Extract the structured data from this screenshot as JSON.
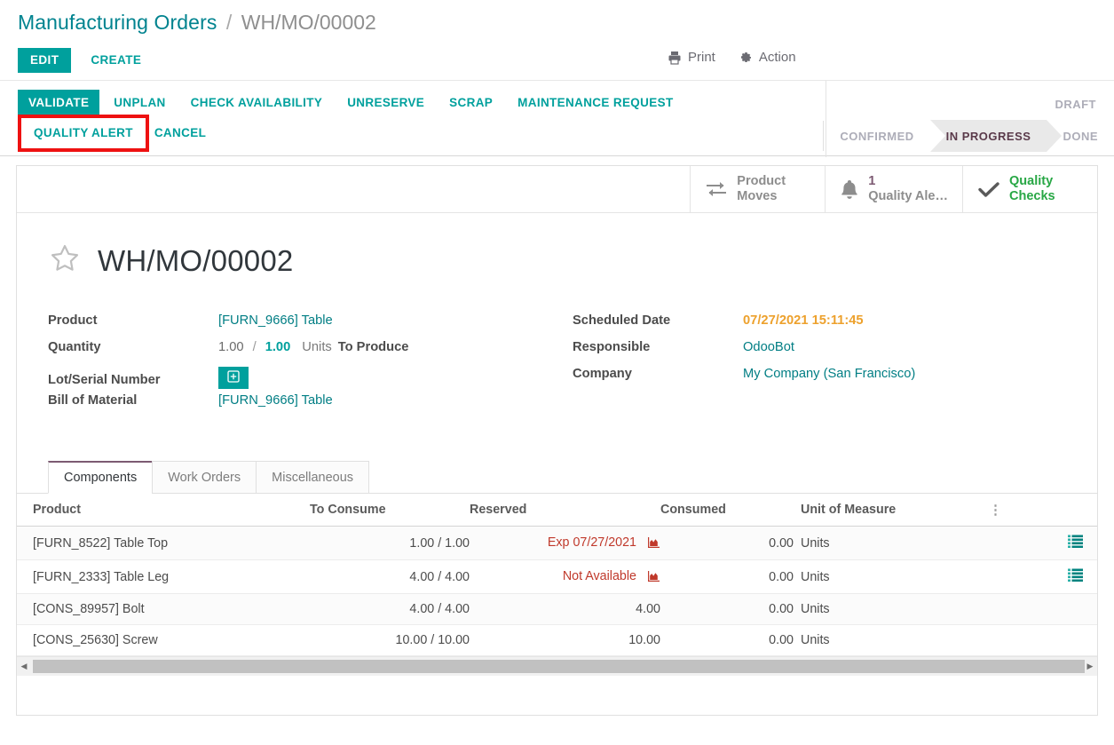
{
  "breadcrumb": {
    "root": "Manufacturing Orders",
    "separator": "/",
    "current": "WH/MO/00002"
  },
  "toolbar": {
    "edit_label": "EDIT",
    "create_label": "CREATE",
    "print_label": "Print",
    "action_label": "Action"
  },
  "action_buttons": [
    {
      "label": "VALIDATE",
      "primary": true
    },
    {
      "label": "UNPLAN",
      "primary": false
    },
    {
      "label": "CHECK AVAILABILITY",
      "primary": false
    },
    {
      "label": "UNRESERVE",
      "primary": false
    },
    {
      "label": "SCRAP",
      "primary": false
    },
    {
      "label": "MAINTENANCE REQUEST",
      "primary": false
    },
    {
      "label": "QUALITY ALERT",
      "primary": false,
      "highlighted": true
    },
    {
      "label": "CANCEL",
      "primary": false
    }
  ],
  "statusbar": {
    "stages": [
      "DRAFT",
      "CONFIRMED",
      "IN PROGRESS",
      "DONE"
    ],
    "draft": "DRAFT",
    "confirmed": "CONFIRMED",
    "in_progress": "IN PROGRESS",
    "done": "DONE",
    "active": "IN PROGRESS"
  },
  "smart_buttons": [
    {
      "icon": "exchange-icon",
      "count": "",
      "label": "Product\nMoves",
      "line1": "Product",
      "line2": "Moves"
    },
    {
      "icon": "bell-icon",
      "count": "1",
      "label": "Quality Ale…",
      "line1": "1",
      "line2": "Quality Ale…"
    },
    {
      "icon": "check-icon",
      "count": "",
      "label": "Quality Checks",
      "line1": "Quality",
      "line2": "Checks"
    }
  ],
  "record": {
    "title": "WH/MO/00002",
    "fields_left": {
      "product_label": "Product",
      "product_value": "[FURN_9666] Table",
      "quantity_label": "Quantity",
      "quantity_done": "1.00",
      "quantity_sep": "/",
      "quantity_todo": "1.00",
      "quantity_uom": "Units",
      "quantity_suffix": "To Produce",
      "lot_label": "Lot/Serial Number",
      "bom_label": "Bill of Material",
      "bom_value": "[FURN_9666] Table"
    },
    "fields_right": {
      "scheduled_label": "Scheduled Date",
      "scheduled_value": "07/27/2021 15:11:45",
      "responsible_label": "Responsible",
      "responsible_value": "OdooBot",
      "company_label": "Company",
      "company_value": "My Company (San Francisco)"
    }
  },
  "notebook": {
    "tabs": [
      {
        "label": "Components",
        "active": true
      },
      {
        "label": "Work Orders",
        "active": false
      },
      {
        "label": "Miscellaneous",
        "active": false
      }
    ]
  },
  "components_table": {
    "columns": [
      "Product",
      "To Consume",
      "Reserved",
      "Consumed",
      "Unit of Measure"
    ],
    "rows": [
      {
        "product": "[FURN_8522] Table Top",
        "to_consume": "1.00 / 1.00",
        "reserved": "Exp 07/27/2021",
        "reserved_state": "warning",
        "consumed": "0.00",
        "uom": "Units",
        "has_detail_icon": true
      },
      {
        "product": "[FURN_2333] Table Leg",
        "to_consume": "4.00 / 4.00",
        "reserved": "Not Available",
        "reserved_state": "warning",
        "consumed": "0.00",
        "uom": "Units",
        "has_detail_icon": true
      },
      {
        "product": "[CONS_89957] Bolt",
        "to_consume": "4.00 / 4.00",
        "reserved": "4.00",
        "reserved_state": "normal",
        "consumed": "0.00",
        "uom": "Units",
        "has_detail_icon": false
      },
      {
        "product": "[CONS_25630] Screw",
        "to_consume": "10.00 / 10.00",
        "reserved": "10.00",
        "reserved_state": "normal",
        "consumed": "0.00",
        "uom": "Units",
        "has_detail_icon": false
      }
    ]
  },
  "colors": {
    "primary": "#00a09d",
    "link": "#017e84",
    "warning": "#eda12d",
    "danger": "#c0392b",
    "highlight": "#ee1111",
    "active_stage": "#7c5a72",
    "green": "#28a745"
  }
}
